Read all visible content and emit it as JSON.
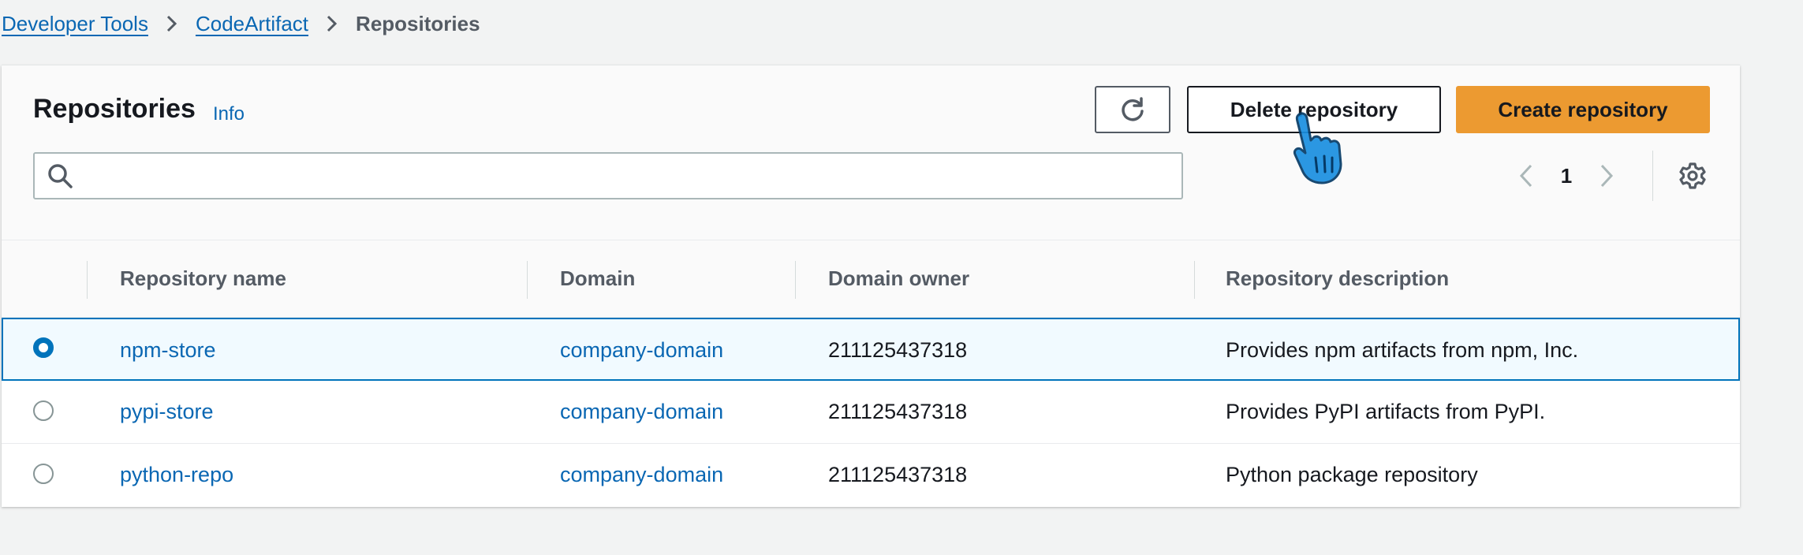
{
  "breadcrumb": {
    "items": [
      {
        "label": "Developer Tools"
      },
      {
        "label": "CodeArtifact"
      },
      {
        "label": "Repositories"
      }
    ]
  },
  "header": {
    "title": "Repositories",
    "info_label": "Info",
    "delete_label": "Delete repository",
    "create_label": "Create repository"
  },
  "search": {
    "placeholder": "",
    "value": ""
  },
  "pagination": {
    "current_page": "1"
  },
  "table": {
    "columns": [
      "Repository name",
      "Domain",
      "Domain owner",
      "Repository description"
    ],
    "rows": [
      {
        "name": "npm-store",
        "domain": "company-domain",
        "owner": "211125437318",
        "description": "Provides npm artifacts from npm, Inc.",
        "selected": true
      },
      {
        "name": "pypi-store",
        "domain": "company-domain",
        "owner": "211125437318",
        "description": "Provides PyPI artifacts from PyPI.",
        "selected": false
      },
      {
        "name": "python-repo",
        "domain": "company-domain",
        "owner": "211125437318",
        "description": "Python package repository",
        "selected": false
      }
    ]
  },
  "colors": {
    "link": "#0a67b3",
    "primary_button": "#ec9a31",
    "selected_row_bg": "#f1faff",
    "selected_row_border": "#0073bb",
    "page_bg": "#f2f3f3"
  }
}
